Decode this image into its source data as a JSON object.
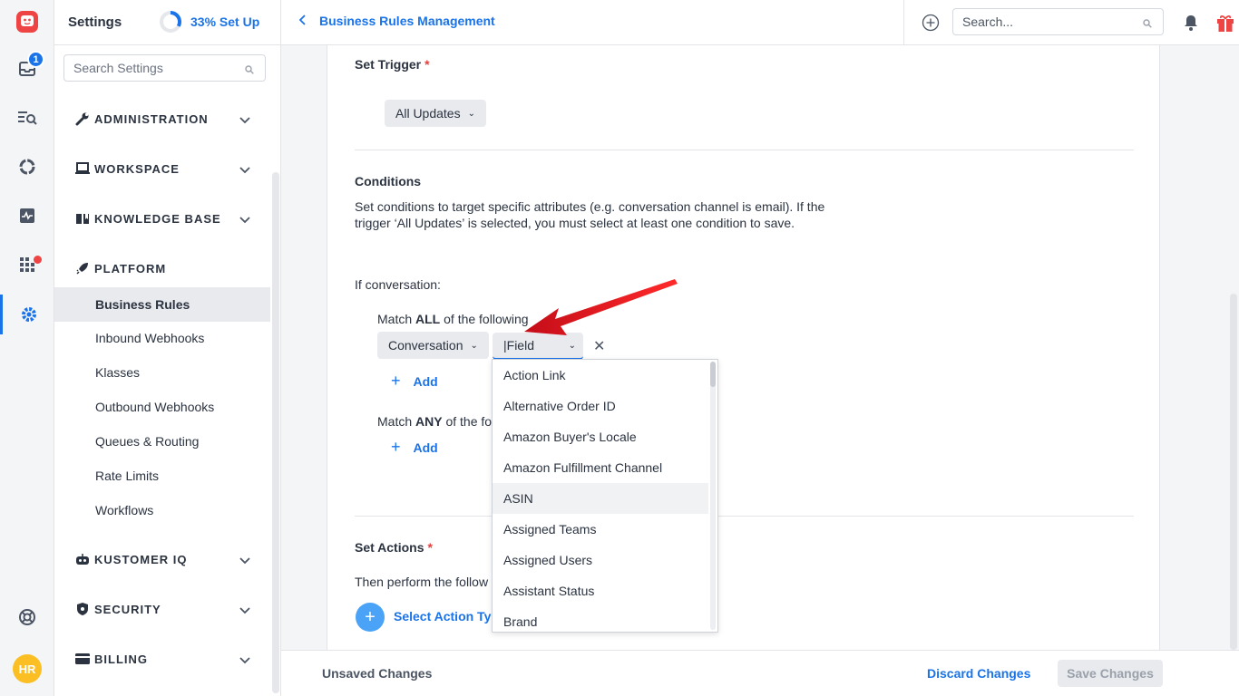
{
  "rail": {
    "inbox_badge": "1",
    "avatar_initials": "HR"
  },
  "sidebar": {
    "title": "Settings",
    "setup_progress": "33% Set Up",
    "setup_fraction": 0.33,
    "search_placeholder": "Search Settings",
    "sections": [
      {
        "label": "ADMINISTRATION",
        "icon": "wrench-icon"
      },
      {
        "label": "WORKSPACE",
        "icon": "laptop-icon"
      },
      {
        "label": "KNOWLEDGE BASE",
        "icon": "book-icon"
      },
      {
        "label": "PLATFORM",
        "icon": "rocket-icon"
      },
      {
        "label": "KUSTOMER IQ",
        "icon": "robot-icon"
      },
      {
        "label": "SECURITY",
        "icon": "shield-icon"
      },
      {
        "label": "BILLING",
        "icon": "card-icon"
      }
    ],
    "platform_items": [
      "Business Rules",
      "Inbound Webhooks",
      "Klasses",
      "Outbound Webhooks",
      "Queues & Routing",
      "Rate Limits",
      "Workflows"
    ]
  },
  "topbar": {
    "breadcrumb": "Business Rules Management",
    "search_placeholder": "Search..."
  },
  "trigger": {
    "heading": "Set Trigger",
    "required_mark": "*",
    "value": "All Updates"
  },
  "conditions": {
    "heading": "Conditions",
    "description_line1": "Set conditions to target specific attributes (e.g. conversation channel is email). If the",
    "description_line2": "trigger ‘All Updates’ is selected, you must select at least one condition to save.",
    "if_label": "If conversation:",
    "match_all_prefix": "Match ",
    "match_all_bold": "ALL",
    "match_all_suffix": " of the following",
    "object_select": "Conversation",
    "field_select": "|Field",
    "add_label": "Add",
    "match_any_prefix": "Match ",
    "match_any_bold": "ANY",
    "match_any_suffix": " of the fo",
    "add_label_2": "Add"
  },
  "field_dropdown": {
    "options": [
      "Action Link",
      "Alternative Order ID",
      "Amazon Buyer's Locale",
      "Amazon Fulfillment Channel",
      "ASIN",
      "Assigned Teams",
      "Assigned Users",
      "Assistant Status",
      "Brand"
    ],
    "highlighted": "ASIN"
  },
  "actions": {
    "heading": "Set Actions",
    "required_mark": "*",
    "subtext": "Then perform the follow",
    "select_action": "Select Action Typ"
  },
  "footer": {
    "status": "Unsaved Changes",
    "discard": "Discard Changes",
    "save": "Save Changes"
  },
  "colors": {
    "accent": "#1a73e8",
    "annotation_arrow": "#e3101d"
  }
}
